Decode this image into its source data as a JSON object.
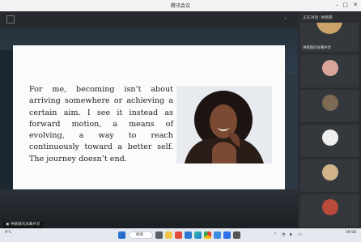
{
  "window": {
    "title": "腾讯会议"
  },
  "slide": {
    "quote": "For me, becoming isn’t about arriving somewhere or achieving a certain aim. I see it instead as forward motion, a means of evolving, a way to reach continuously toward a better self. The journey doesn’t end."
  },
  "share_label": "钟薇薇的屏幕共享",
  "sidebar": {
    "header": "正在讲话: 钟薇薇",
    "participants": [
      {
        "name": "钟薇薇的屏幕共享",
        "avatar_color": "#caa26a"
      },
      {
        "name": "",
        "avatar_color": "#d9a59b"
      },
      {
        "name": "",
        "avatar_color": "#7c6a55"
      },
      {
        "name": "",
        "avatar_color": "#eeeeee"
      },
      {
        "name": "",
        "avatar_color": "#d2b48c"
      },
      {
        "name": "",
        "avatar_color": "#b84b3a"
      }
    ]
  },
  "taskbar": {
    "weather": "9°C",
    "weather_sub": "",
    "search": "搜索",
    "time": "19:54",
    "date": ""
  }
}
